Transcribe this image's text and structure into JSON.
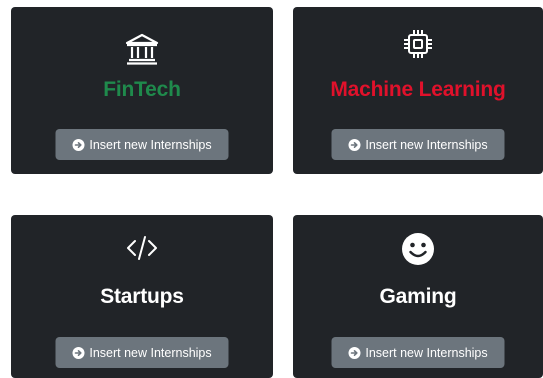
{
  "colors": {
    "card_bg": "#212428",
    "button_bg": "#6c757d",
    "fintech_title": "#1f8a4c",
    "ml_title": "#e0112b",
    "default_title": "#ffffff"
  },
  "cards": [
    {
      "icon": "bank-icon",
      "title": "FinTech",
      "button_label": "Insert new Internships"
    },
    {
      "icon": "chip-icon",
      "title": "Machine Learning",
      "button_label": "Insert new Internships"
    },
    {
      "icon": "code-icon",
      "title": "Startups",
      "button_label": "Insert new Internships"
    },
    {
      "icon": "smiley-icon",
      "title": "Gaming",
      "button_label": "Insert new Internships"
    }
  ]
}
